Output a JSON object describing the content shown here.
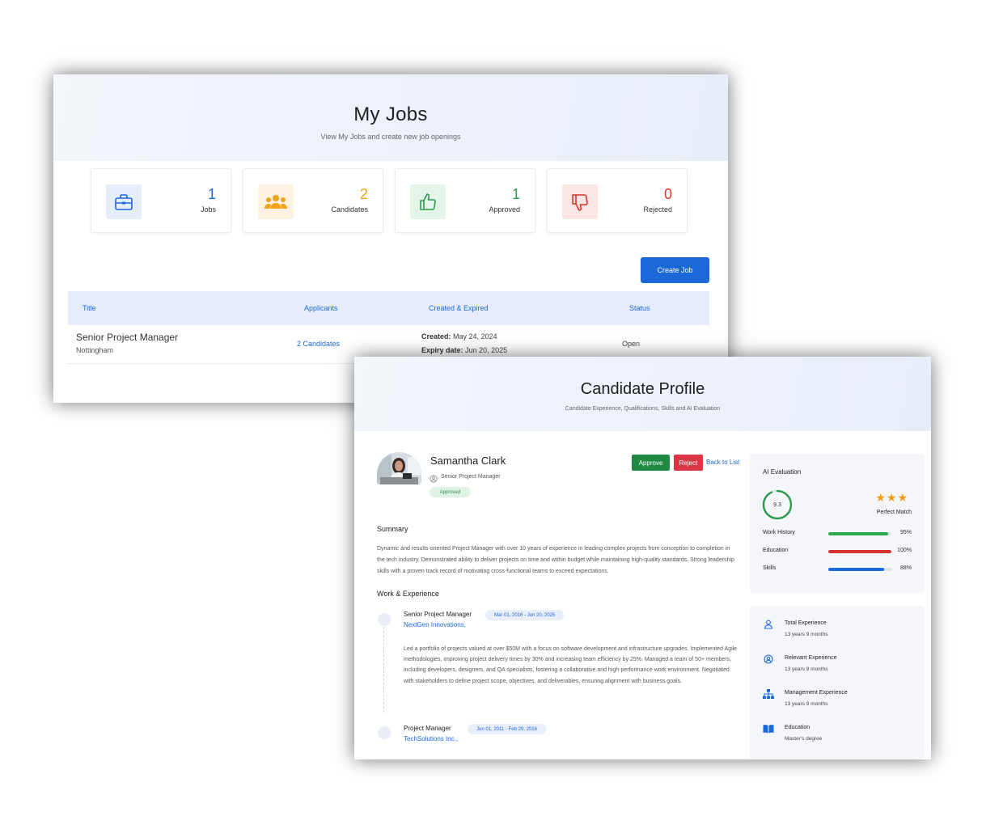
{
  "jobs": {
    "title": "My Jobs",
    "subtitle": "View My Jobs and create new job openings",
    "stats": [
      {
        "value": "1",
        "label": "Jobs",
        "icon": "briefcase-icon",
        "color": "#1b68d8",
        "bg": "#e6eefb"
      },
      {
        "value": "2",
        "label": "Candidates",
        "icon": "users-icon",
        "color": "#f0a21b",
        "bg": "#fdf1e1"
      },
      {
        "value": "1",
        "label": "Approved",
        "icon": "thumbs-up-icon",
        "color": "#2e9a4d",
        "bg": "#e5f4e9"
      },
      {
        "value": "0",
        "label": "Rejected",
        "icon": "thumbs-down-icon",
        "color": "#d9342b",
        "bg": "#fbe6e5"
      }
    ],
    "create_button": "Create Job",
    "table": {
      "headers": [
        "Title",
        "Applicants",
        "Created & Expired",
        "Status"
      ],
      "rows": [
        {
          "title": "Senior Project Manager",
          "location": "Nottingham",
          "applicants": "2 Candidates",
          "created_label": "Created:",
          "created": "May 24, 2024",
          "expiry_label": "Expiry date:",
          "expiry": "Jun 20, 2025",
          "status": "Open"
        }
      ]
    }
  },
  "profile": {
    "title": "Candidate Profile",
    "subtitle": "Candidate Experience, Qualifications, Skills and AI Evaluation",
    "name": "Samantha Clark",
    "role": "Senior Project Manager",
    "badge": "Approved",
    "buttons": {
      "approve": "Approve",
      "reject": "Reject",
      "back": "Back to List"
    },
    "summary_title": "Summary",
    "summary": "Dynamic and results-oriented Project Manager with over 10 years of experience in leading complex projects from conception to completion in the tech industry. Demonstrated ability to deliver projects on time and within budget while maintaining high-quality standards. Strong leadership skills with a proven track record of motivating cross-functional teams to exceed expectations.",
    "work_title": "Work & Experience",
    "jobs": [
      {
        "title": "Senior Project Manager",
        "dates": "Mar 01, 2016 - Jun 20, 2025",
        "company": "NextGen Innovations,",
        "description": "Led a portfolio of projects valued at over $50M with a focus on software development and infrastructure upgrades. Implemented Agile methodologies, improving project delivery times by 30% and increasing team efficiency by 25%. Managed a team of 50+ members, including developers, designers, and QA specialists, fostering a collaborative and high-performance work environment. Negotiated with stakeholders to define project scope, objectives, and deliverables, ensuring alignment with business goals."
      },
      {
        "title": "Project Manager",
        "dates": "Jun 01, 2011 - Feb 29, 2016",
        "company": "TechSolutions Inc.,"
      }
    ],
    "ai": {
      "title": "AI Evaluation",
      "score": "9.3",
      "score_fraction": 0.93,
      "stars": "★★★",
      "match": "Perfect Match",
      "bars": [
        {
          "label": "Work History",
          "pct": "95%",
          "value": 95,
          "color": "#2ea84f"
        },
        {
          "label": "Education",
          "pct": "100%",
          "value": 100,
          "color": "#d63232"
        },
        {
          "label": "Skills",
          "pct": "88%",
          "value": 88,
          "color": "#1b68d8"
        }
      ]
    },
    "experience": [
      {
        "label": "Total Experience",
        "value": "13 years 9 months",
        "icon": "person-icon"
      },
      {
        "label": "Relevant Experience",
        "value": "13 years 9 months",
        "icon": "user-circle-icon"
      },
      {
        "label": "Management Experience",
        "value": "13 years 9 months",
        "icon": "org-chart-icon"
      },
      {
        "label": "Education",
        "value": "Master's degree",
        "icon": "book-icon"
      }
    ]
  }
}
